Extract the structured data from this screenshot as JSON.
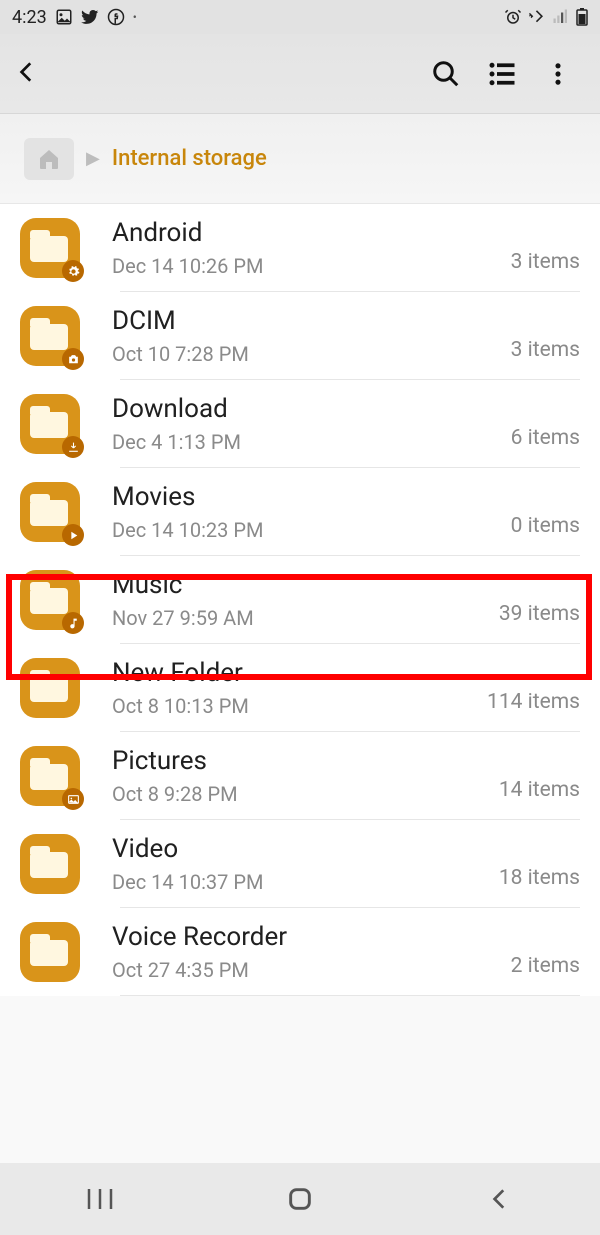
{
  "status": {
    "time": "4:23"
  },
  "breadcrumb": {
    "label": "Internal storage"
  },
  "folders": [
    {
      "name": "Android",
      "date": "Dec 14 10:26 PM",
      "count": "3 items",
      "badge": "gear"
    },
    {
      "name": "DCIM",
      "date": "Oct 10 7:28 PM",
      "count": "3 items",
      "badge": "camera"
    },
    {
      "name": "Download",
      "date": "Dec 4 1:13 PM",
      "count": "6 items",
      "badge": "download",
      "highlighted": true
    },
    {
      "name": "Movies",
      "date": "Dec 14 10:23 PM",
      "count": "0 items",
      "badge": "play"
    },
    {
      "name": "Music",
      "date": "Nov 27 9:59 AM",
      "count": "39 items",
      "badge": "music"
    },
    {
      "name": "New Folder",
      "date": "Oct 8 10:13 PM",
      "count": "114 items",
      "badge": ""
    },
    {
      "name": "Pictures",
      "date": "Oct 8 9:28 PM",
      "count": "14 items",
      "badge": "image"
    },
    {
      "name": "Video",
      "date": "Dec 14 10:37 PM",
      "count": "18 items",
      "badge": ""
    },
    {
      "name": "Voice Recorder",
      "date": "Oct 27 4:35 PM",
      "count": "2 items",
      "badge": ""
    }
  ]
}
